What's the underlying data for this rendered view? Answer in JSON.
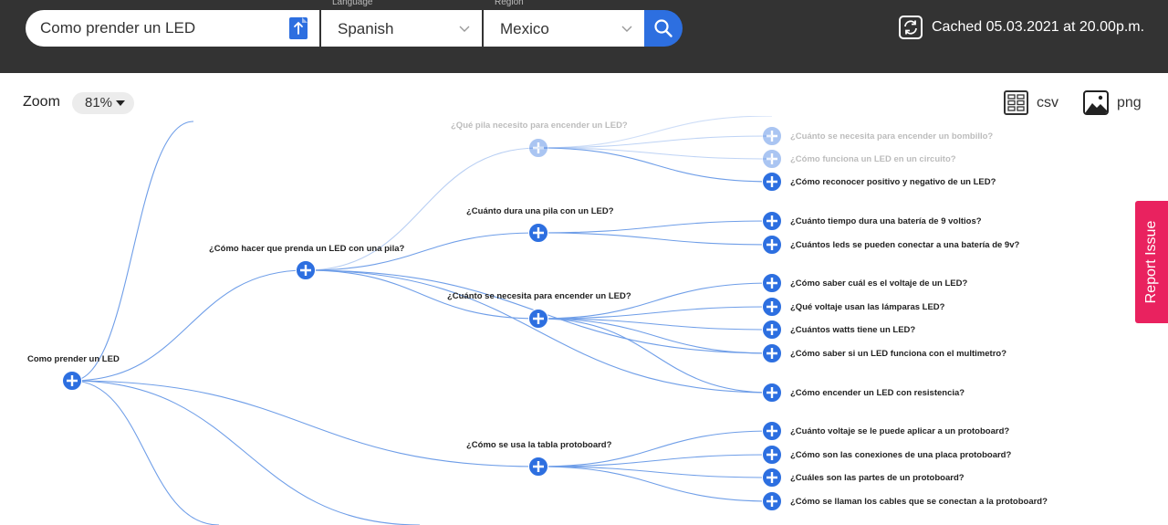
{
  "search": {
    "value": "Como prender un LED"
  },
  "language": {
    "caption": "Language",
    "value": "Spanish"
  },
  "region": {
    "caption": "Region",
    "value": "Mexico"
  },
  "cache": {
    "text": "Cached 05.03.2021 at 20.00p.m."
  },
  "zoom": {
    "label": "Zoom",
    "value": "81%"
  },
  "export": {
    "csv": "csv",
    "png": "png"
  },
  "report": {
    "label": "Report Issue"
  },
  "colors": {
    "topbar": "#333333",
    "accent": "#2d6fe0",
    "link": "#6f9ee8",
    "report": "#e9225f"
  },
  "tree": {
    "root": "Como prender un LED",
    "level1": [
      "¿Cómo hacer que prenda un LED con una pila?"
    ],
    "level2": [
      "¿Qué pila necesito para encender un LED?",
      "¿Cuánto dura una pila con un LED?",
      "¿Cuánto se necesita para encender un LED?",
      "¿Cómo se usa la tabla protoboard?"
    ],
    "level3": [
      "¿Cuánto se necesita para encender un bombillo?",
      "¿Cómo funciona un LED en un circuito?",
      "¿Cómo reconocer positivo y negativo de un LED?",
      "¿Cuánto tiempo dura una batería de 9 voltios?",
      "¿Cuántos leds se pueden conectar a una batería de 9v?",
      "¿Cómo saber cuál es el voltaje de un LED?",
      "¿Qué voltaje usan las lámparas LED?",
      "¿Cuántos watts tiene un LED?",
      "¿Cómo saber si un LED funciona con el multimetro?",
      "¿Cómo encender un LED con resistencia?",
      "¿Cuánto voltaje se le puede aplicar a un protoboard?",
      "¿Cómo son las conexiones de una placa protoboard?",
      "¿Cuáles son las partes de un protoboard?",
      "¿Cómo se llaman los cables que se conectan a la protoboard?"
    ]
  }
}
